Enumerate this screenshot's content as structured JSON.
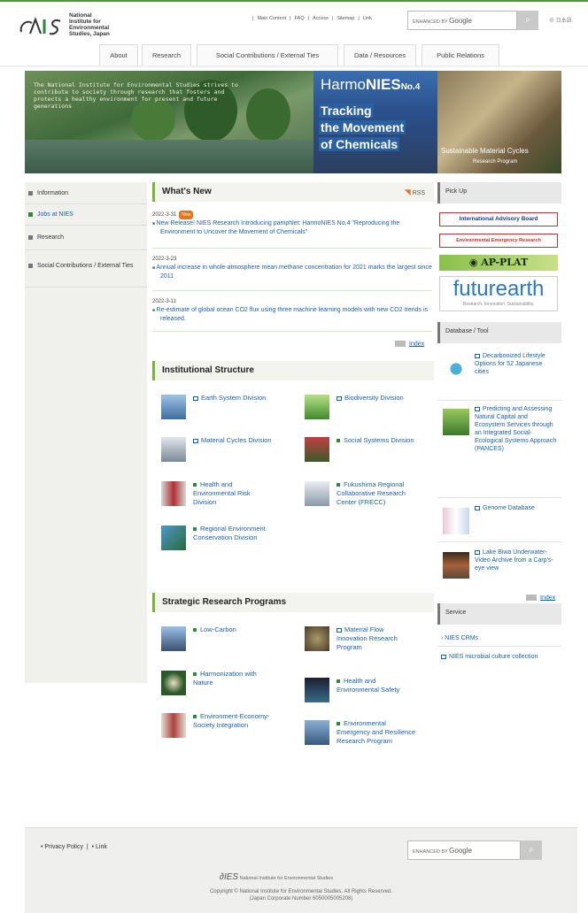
{
  "header": {
    "org_name_lines": [
      "National",
      "Institute for",
      "Environmental",
      "Studies, Japan"
    ],
    "utility_links": [
      "Main Content",
      "FAQ",
      "Access",
      "Sitemap",
      "Link"
    ],
    "search_placeholder": "ENHANCED BY",
    "search_brand": "Google",
    "lang_link": "日本語"
  },
  "nav": [
    "About",
    "Research",
    "Social Contributions / External Ties",
    "Data / Resources",
    "Public Relations"
  ],
  "hero": {
    "panel1_text": "The National Institute for Environmental Studies strives to contribute to society through research that fosters and protects a healthy environment for present and future generations",
    "panel2_title": "Harmo",
    "panel2_title_bold": "NIES",
    "panel2_issue": "No.4",
    "panel2_lines": [
      "Tracking",
      "the Movement",
      "of Chemicals"
    ],
    "panel3_title": "Sustainable Material Cycles",
    "panel3_sub": "Research Program"
  },
  "left_nav": [
    "Information",
    "Jobs at NIES",
    "Research",
    "Social Contributions / External Ties"
  ],
  "whats_new": {
    "title": "What's New",
    "rss": "RSS",
    "new_badge": "New",
    "items": [
      {
        "date": "2022-3-31",
        "text": "New Release! NIES Research Introducing pamphlet: HarmoNIES No.4 \"Reproducing the Environment to Uncover the Movement of Chemicals\""
      },
      {
        "date": "2022-3-23",
        "text": "Annual increase in whole-atmosphere mean methane concentration for 2021 marks the largest since 2011"
      },
      {
        "date": "2022-3-11",
        "text": "Re-estimate of global ocean CO2 flux using three machine learning models with new CO2 trends is released."
      }
    ],
    "index": "Index"
  },
  "institutional": {
    "title": "Institutional Structure",
    "items": [
      "Earth System Division",
      "Biodiversity Division",
      "Material Cycles Division",
      "Social Systems Division",
      "Health and Environmental Risk Division",
      "Fukushima Regional Collaborative Research Center (FRECC)",
      "Regional Environment Conservation Division"
    ]
  },
  "strategic": {
    "title": "Strategic Research Programs",
    "items": [
      "Low-Carbon",
      "Material Flow Innovation Research Program",
      "Harmonization with Nature",
      "Health and Environmental Safety",
      "Environment-Economy-Society Integration",
      "Environmental Emergency and Resilience Research Program"
    ]
  },
  "pickup": {
    "title": "Pick Up",
    "banners": [
      "International Advisory Board",
      "Environmental Emergency Research",
      "AP-PLAT",
      "futurearth",
      "Research. Innovation. Sustainability."
    ]
  },
  "database": {
    "title": "Database / Tool",
    "items": [
      "Decarbonized Lifestyle Options for 52 Japanese cities",
      "Predicting and Assessing Natural Capital and Ecosystem Services through an Integrated Social-Ecological Systems Approach (PANCES)",
      "Genome Database",
      "Lake Biwa Underwater-Video Archive from a Carp's-eye view"
    ],
    "index": "Index"
  },
  "service": {
    "title": "Service",
    "items": [
      "NIES CRMs",
      "NIES microbial culture collection"
    ]
  },
  "footer": {
    "links": [
      "Privacy Policy",
      "Link"
    ],
    "search_placeholder": "ENHANCED BY",
    "search_brand": "Google",
    "logo_text": "National Institute for Environmental Studies",
    "copyright": "Copyright © National Institute for Environmental Studies. All Rights Reserved.",
    "corporate_number": "(Japan Corporate Number 6050005005208)"
  },
  "colors": {
    "accent_green": "#7ab338",
    "link_blue": "#1a5fb4",
    "badge_orange": "#e8751a"
  }
}
